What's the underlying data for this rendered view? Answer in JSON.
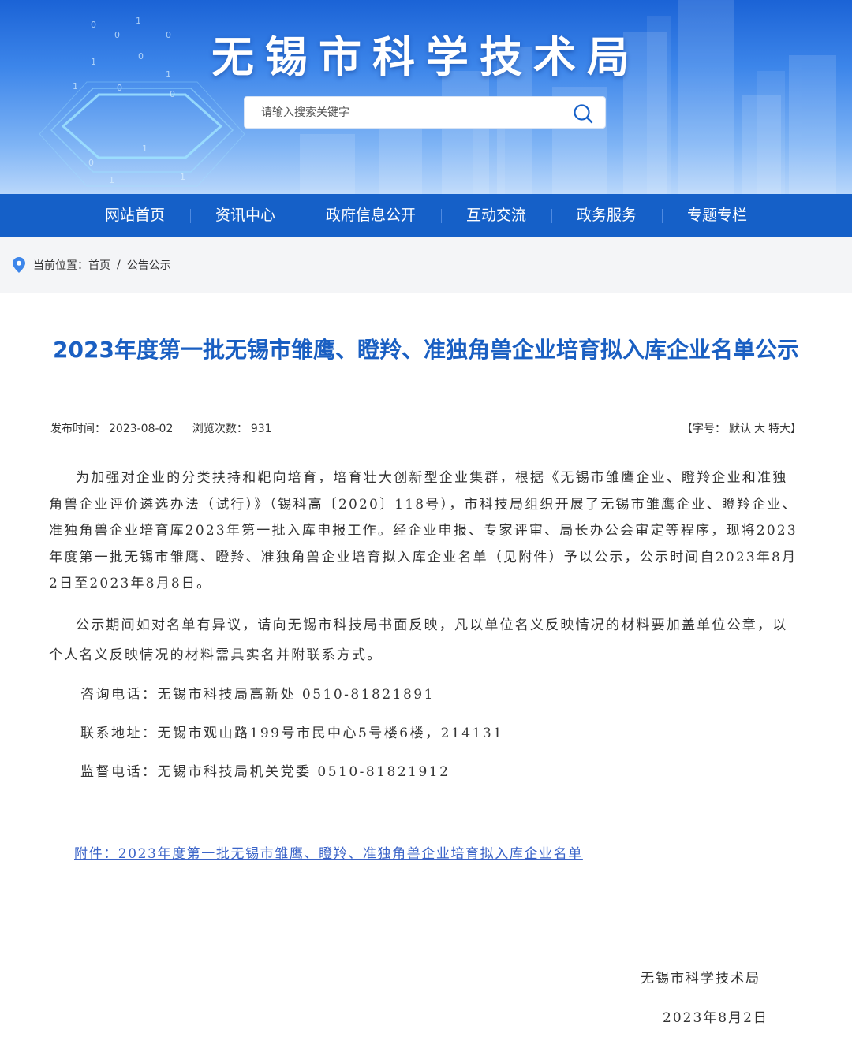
{
  "header": {
    "site_title": "无锡市科学技术局",
    "search_placeholder": "请输入搜索关键字"
  },
  "nav": {
    "items": [
      "网站首页",
      "资讯中心",
      "政府信息公开",
      "互动交流",
      "政务服务",
      "专题专栏"
    ]
  },
  "breadcrumb": {
    "label": "当前位置：",
    "home": "首页",
    "separator": "/",
    "current": "公告公示"
  },
  "article": {
    "title": "2023年度第一批无锡市雏鹰、瞪羚、准独角兽企业培育拟入库企业名单公示",
    "publish_label": "发布时间：",
    "publish_date": "2023-08-02",
    "views_label": "浏览次数：",
    "views": "931",
    "font_size_prefix": "【字号：",
    "font_size_default": "默认",
    "font_size_large": "大",
    "font_size_xlarge": "特大",
    "font_size_suffix": "】",
    "paragraph1": "为加强对企业的分类扶持和靶向培育，培育壮大创新型企业集群，根据《无锡市雏鹰企业、瞪羚企业和准独角兽企业评价遴选办法（试行）》（锡科高〔2020〕118号），市科技局组织开展了无锡市雏鹰企业、瞪羚企业、准独角兽企业培育库2023年第一批入库申报工作。经企业申报、专家评审、局长办公会审定等程序，现将2023年度第一批无锡市雏鹰、瞪羚、准独角兽企业培育拟入库企业名单（见附件）予以公示，公示时间自2023年8月2日至2023年8月8日。",
    "paragraph2": "公示期间如对名单有异议，请向无锡市科技局书面反映，凡以单位名义反映情况的材料要加盖单位公章，以个人名义反映情况的材料需具实名并附联系方式。",
    "contact_phone": "咨询电话：无锡市科技局高新处 0510-81821891",
    "contact_address": "联系地址：无锡市观山路199号市民中心5号楼6楼，214131",
    "supervise_phone": "监督电话：无锡市科技局机关党委 0510-81821912",
    "attachment": "附件：2023年度第一批无锡市雏鹰、瞪羚、准独角兽企业培育拟入库企业名单",
    "signature": "无锡市科学技术局",
    "sign_date": "2023年8月2日"
  },
  "colors": {
    "nav_bg": "#1560c8",
    "title_blue": "#1a5fc2",
    "link_blue": "#3b64c8",
    "crumb_bg": "#f4f5f7"
  }
}
